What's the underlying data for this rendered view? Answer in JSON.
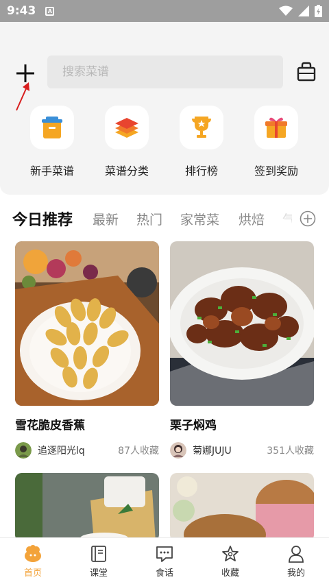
{
  "status_bar": {
    "time": "9:43",
    "notification": "A"
  },
  "search": {
    "placeholder": "搜索菜谱"
  },
  "quick_links": [
    {
      "label": "新手菜谱",
      "icon": "basket-icon"
    },
    {
      "label": "菜谱分类",
      "icon": "layers-icon"
    },
    {
      "label": "排行榜",
      "icon": "trophy-icon"
    },
    {
      "label": "签到奖励",
      "icon": "gift-icon"
    }
  ],
  "tabs": [
    "今日推荐",
    "最新",
    "热门",
    "家常菜",
    "烘焙",
    "气"
  ],
  "recipes": [
    {
      "title": "雪花脆皮香蕉",
      "author": "追逐阳光lq",
      "favorites": "87人收藏"
    },
    {
      "title": "栗子焖鸡",
      "author": "菊娜JUJU",
      "favorites": "351人收藏"
    }
  ],
  "bottom_nav": [
    {
      "label": "首页",
      "active": true
    },
    {
      "label": "课堂"
    },
    {
      "label": "食话"
    },
    {
      "label": "收藏"
    },
    {
      "label": "我的"
    }
  ],
  "colors": {
    "accent": "#f3a33a",
    "panel": "#f4f4f4"
  }
}
